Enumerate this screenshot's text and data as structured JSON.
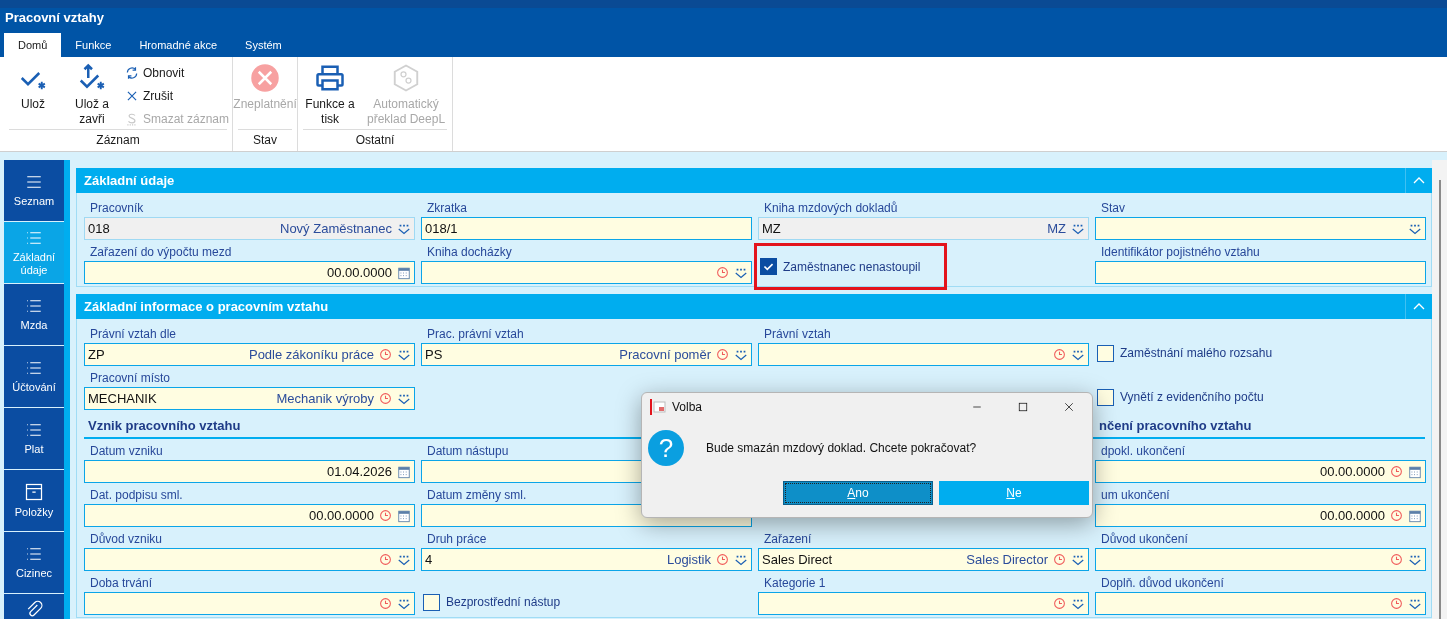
{
  "window": {
    "title": "Pracovní vztahy"
  },
  "ribbon_tabs": [
    {
      "label": "Domů",
      "selected": true
    },
    {
      "label": "Funkce",
      "selected": false
    },
    {
      "label": "Hromadné akce",
      "selected": false
    },
    {
      "label": "Systém",
      "selected": false
    }
  ],
  "ribbon_groups": [
    {
      "label": "Záznam",
      "items": [
        {
          "kind": "large",
          "label": "Ulož",
          "disabled": false
        },
        {
          "kind": "large",
          "label": "Ulož a zavři",
          "disabled": false
        },
        {
          "kind": "small",
          "label": "Obnovit",
          "disabled": false
        },
        {
          "kind": "small",
          "label": "Zrušit",
          "disabled": false
        },
        {
          "kind": "small",
          "label": "Smazat záznam",
          "disabled": true
        }
      ]
    },
    {
      "label": "Stav",
      "items": [
        {
          "kind": "large",
          "label": "Zneplatnění",
          "disabled": true
        }
      ]
    },
    {
      "label": "Ostatní",
      "items": [
        {
          "kind": "large",
          "label": "Funkce a tisk",
          "disabled": false
        },
        {
          "kind": "large",
          "label": "Automatický překlad DeepL",
          "disabled": true
        }
      ]
    }
  ],
  "sidebar": {
    "items": [
      {
        "label": "Seznam",
        "selected": false
      },
      {
        "label": "Základní údaje",
        "selected": true
      },
      {
        "label": "Mzda",
        "selected": false
      },
      {
        "label": "Účtování",
        "selected": false
      },
      {
        "label": "Plat",
        "selected": false
      },
      {
        "label": "Položky",
        "selected": false
      },
      {
        "label": "Cizinec",
        "selected": false
      }
    ]
  },
  "sections": [
    {
      "title": "Základní údaje",
      "expanded": true,
      "rows": [
        [
          {
            "kind": "lookup",
            "label": "Pracovník",
            "value": "018",
            "description": "Nový Zaměstnanec",
            "readonly": true,
            "history": false
          },
          {
            "kind": "text",
            "label": "Zkratka",
            "value": "018/1",
            "readonly": false
          },
          {
            "kind": "lookup",
            "label": "Kniha mzdových dokladů",
            "value": "MZ",
            "description": "MZ",
            "readonly": true,
            "history": false
          },
          {
            "kind": "lookup",
            "label": "Stav",
            "readonly": false,
            "history": false
          }
        ],
        [
          {
            "kind": "date",
            "label": "Zařazení do výpočtu mezd",
            "value": "00.00.0000",
            "readonly": false,
            "history": false
          },
          {
            "kind": "lookup",
            "label": "Kniha docházky",
            "readonly": false,
            "history": true
          },
          {
            "kind": "checkbox",
            "label": "Zaměstnanec nenastoupil",
            "checked": true,
            "highlighted": true
          },
          {
            "kind": "text",
            "label": "Identifikátor pojistného vztahu",
            "readonly": false
          }
        ]
      ]
    },
    {
      "title": "Základní informace o pracovním vztahu",
      "expanded": true,
      "rows": [
        [
          {
            "kind": "lookup",
            "label": "Právní vztah dle",
            "value": "ZP",
            "description": "Podle zákoníku práce",
            "readonly": false,
            "history": true
          },
          {
            "kind": "lookup",
            "label": "Prac. právní vztah",
            "value": "PS",
            "description": "Pracovní poměr",
            "readonly": false,
            "history": true
          },
          {
            "kind": "lookup",
            "label": "Právní vztah",
            "readonly": false,
            "history": true
          },
          {
            "kind": "checkbox",
            "label": "Zaměstnání malého rozsahu",
            "checked": false,
            "highlighted": false
          }
        ],
        [
          {
            "kind": "lookup",
            "label": "Pracovní místo",
            "value": "MECHANIK",
            "description": "Mechanik výroby",
            "readonly": false,
            "history": true
          },
          {
            "kind": "empty"
          },
          {
            "kind": "empty"
          },
          {
            "kind": "checkbox",
            "label": "Vynětí z evidenčního počtu",
            "checked": false,
            "highlighted": false
          }
        ],
        [
          {
            "kind": "heading",
            "label": "Vznik pracovního vztahu"
          },
          {
            "kind": "empty"
          },
          {
            "kind": "empty"
          },
          {
            "kind": "heading",
            "label": "nčení pracovního vztahu"
          }
        ],
        [
          {
            "kind": "date",
            "label": "Datum vzniku",
            "value": "01.04.2026",
            "readonly": false,
            "history": false
          },
          {
            "kind": "text",
            "label": "Datum nástupu",
            "readonly": false
          },
          {
            "kind": "empty"
          },
          {
            "kind": "date",
            "label": "dpokl. ukončení",
            "value": "00.00.0000",
            "readonly": false,
            "history": true
          }
        ],
        [
          {
            "kind": "date",
            "label": "Dat. podpisu sml.",
            "value": "00.00.0000",
            "readonly": false,
            "history": true
          },
          {
            "kind": "text",
            "label": "Datum změny sml.",
            "readonly": false
          },
          {
            "kind": "empty"
          },
          {
            "kind": "date",
            "label": "um ukončení",
            "value": "00.00.0000",
            "readonly": false,
            "history": true
          }
        ],
        [
          {
            "kind": "lookup",
            "label": "Důvod vzniku",
            "readonly": false,
            "history": true
          },
          {
            "kind": "lookup",
            "label": "Druh práce",
            "value": "4",
            "description": "Logistik",
            "readonly": false,
            "history": true
          },
          {
            "kind": "lookup",
            "label": "Zařazení",
            "value": "Sales Direct",
            "description": "Sales Director",
            "readonly": false,
            "history": true
          },
          {
            "kind": "lookup",
            "label": "Důvod ukončení",
            "readonly": false,
            "history": true
          }
        ],
        [
          {
            "kind": "lookup",
            "label": "Doba trvání",
            "readonly": false,
            "history": true
          },
          {
            "kind": "checkbox",
            "label": "Bezprostřední nástup",
            "checked": false,
            "highlighted": false
          },
          {
            "kind": "lookup",
            "label": "Kategorie 1",
            "readonly": false,
            "history": true
          },
          {
            "kind": "lookup",
            "label": "Doplň. důvod ukončení",
            "readonly": false,
            "history": true
          }
        ]
      ]
    }
  ],
  "dialog": {
    "title": "Volba",
    "icon": "?",
    "message": "Bude smazán mzdový doklad. Chcete pokračovat?",
    "buttons": [
      {
        "label": "Ano",
        "default": true
      },
      {
        "label": "Ne",
        "default": false
      }
    ]
  }
}
